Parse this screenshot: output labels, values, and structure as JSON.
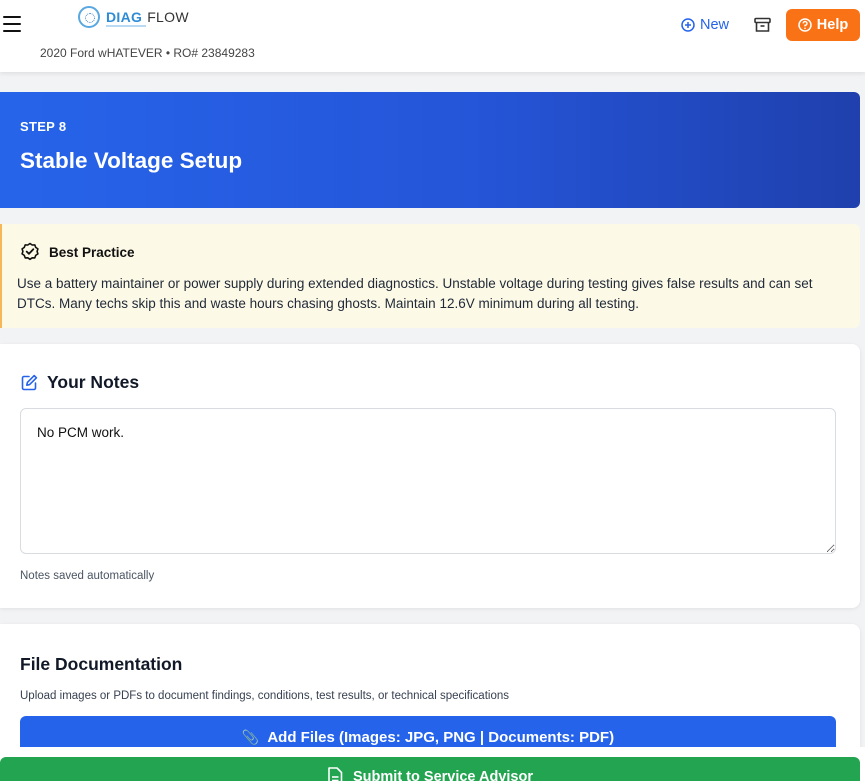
{
  "header": {
    "logo_diag": "DIAG",
    "logo_flow": "FLOW",
    "vehicle_info": "2020 Ford wHATEVER • RO# 23849283",
    "new_label": "New",
    "help_label": "Help"
  },
  "step": {
    "label": "STEP 8",
    "title": "Stable Voltage Setup"
  },
  "best_practice": {
    "heading": "Best Practice",
    "body": "Use a battery maintainer or power supply during extended diagnostics. Unstable voltage during testing gives false results and can set DTCs. Many techs skip this and waste hours chasing ghosts. Maintain 12.6V minimum during all testing."
  },
  "notes": {
    "title": "Your Notes",
    "value": "No PCM work.",
    "hint": "Notes saved automatically"
  },
  "files": {
    "title": "File Documentation",
    "description": "Upload images or PDFs to document findings, conditions, test results, or technical specifications",
    "add_label": "Add Files (Images: JPG, PNG | Documents: PDF)"
  },
  "submit": {
    "label": "Submit to Service Advisor"
  },
  "colors": {
    "primary": "#2563eb",
    "help_orange": "#f97316",
    "submit_green": "#22a450",
    "best_bg": "#fdf9e7"
  }
}
